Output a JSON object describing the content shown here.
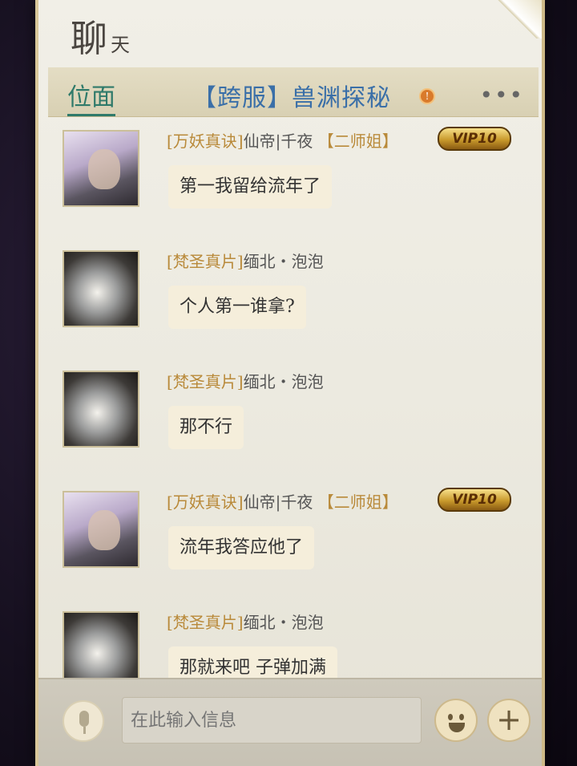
{
  "header": {
    "title": "聊",
    "title_small": "天"
  },
  "topbar": {
    "tab_label": "位面",
    "channel_title": "【跨服】兽渊探秘",
    "more_label": "•••"
  },
  "messages": [
    {
      "guild": "[万妖真诀]",
      "name": "仙帝|千夜",
      "title": "【二师姐】",
      "vip": "VIP10",
      "text": "第一我留给流年了",
      "avatar": "hero"
    },
    {
      "guild": "[梵圣真片]",
      "name": "缅北・泡泡",
      "title": "",
      "vip": "",
      "text": "个人第一谁拿?",
      "avatar": "dragon"
    },
    {
      "guild": "[梵圣真片]",
      "name": "缅北・泡泡",
      "title": "",
      "vip": "",
      "text": "那不行",
      "avatar": "dragon"
    },
    {
      "guild": "[万妖真诀]",
      "name": "仙帝|千夜",
      "title": "【二师姐】",
      "vip": "VIP10",
      "text": "流年我答应他了",
      "avatar": "hero"
    },
    {
      "guild": "[梵圣真片]",
      "name": "缅北・泡泡",
      "title": "",
      "vip": "",
      "text": "那就来吧 子弹加满",
      "avatar": "dragon"
    }
  ],
  "input": {
    "placeholder": "在此输入信息"
  },
  "icons": {
    "mic": "microphone-icon",
    "emoji": "emoji-icon",
    "plus": "plus-icon",
    "info": "info-icon"
  },
  "colors": {
    "tab_active": "#2f7a6a",
    "channel_title": "#3a6fa8",
    "guild_tag": "#b98a3a",
    "vip_gold": "#c99a2c"
  }
}
